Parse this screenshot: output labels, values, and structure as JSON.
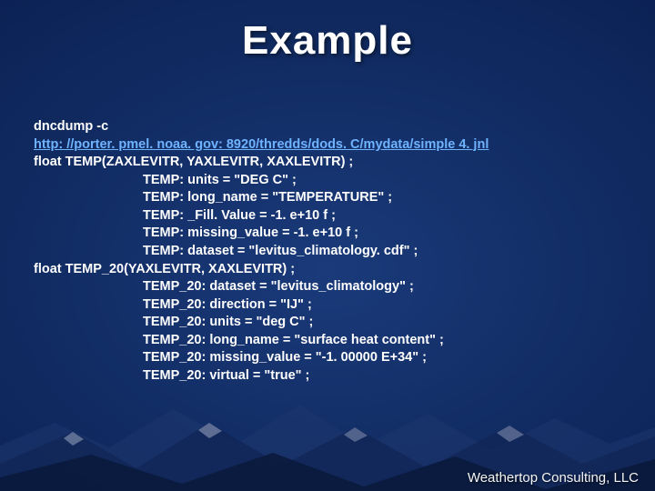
{
  "title": "Example",
  "cmd_line": "dncdump -c",
  "url_text": "http: //porter. pmel. noaa. gov: 8920/thredds/dods. C/mydata/simple 4. jnl",
  "decl_temp": "float TEMP(ZAXLEVITR, YAXLEVITR, XAXLEVITR) ;",
  "temp_attrs": [
    "TEMP: units = \"DEG C\" ;",
    "TEMP: long_name = \"TEMPERATURE\" ;",
    "TEMP: _Fill. Value = -1. e+10 f ;",
    "TEMP: missing_value = -1. e+10 f ;",
    "TEMP: dataset = \"levitus_climatology. cdf\" ;"
  ],
  "decl_temp20": "float TEMP_20(YAXLEVITR, XAXLEVITR) ;",
  "temp20_attrs": [
    "TEMP_20: dataset = \"levitus_climatology\" ;",
    "TEMP_20: direction = \"IJ\" ;",
    "TEMP_20: units = \"deg C\" ;",
    "TEMP_20: long_name = \"surface heat content\" ;",
    "TEMP_20: missing_value = \"-1. 00000 E+34\" ;",
    "TEMP_20: virtual = \"true\" ;"
  ],
  "footer": "Weathertop Consulting, LLC"
}
